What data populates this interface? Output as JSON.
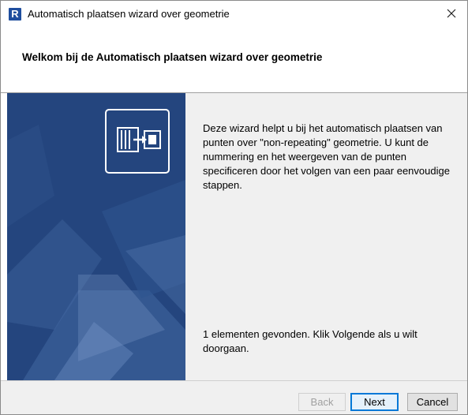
{
  "window": {
    "title": "Automatisch plaatsen wizard over geometrie",
    "app_icon_letter": "R"
  },
  "header": {
    "title": "Welkom bij de Automatisch plaatsen wizard over geometrie"
  },
  "content": {
    "intro": "Deze wizard helpt u bij het automatisch plaatsen van punten over \"non-repeating\" geometrie. U kunt de nummering en het weergeven van de punten specificeren door het volgen van een paar eenvoudige stappen.",
    "found": "1 elementen gevonden. Klik Volgende als u wilt doorgaan."
  },
  "buttons": {
    "back": "Back",
    "next": "Next",
    "cancel": "Cancel"
  },
  "colors": {
    "panel_blue": "#24457e",
    "accent": "#0078d7"
  },
  "icons": {
    "close": "close-icon",
    "app": "revit-app-icon",
    "wizard_logo": "point-placement-icon"
  }
}
